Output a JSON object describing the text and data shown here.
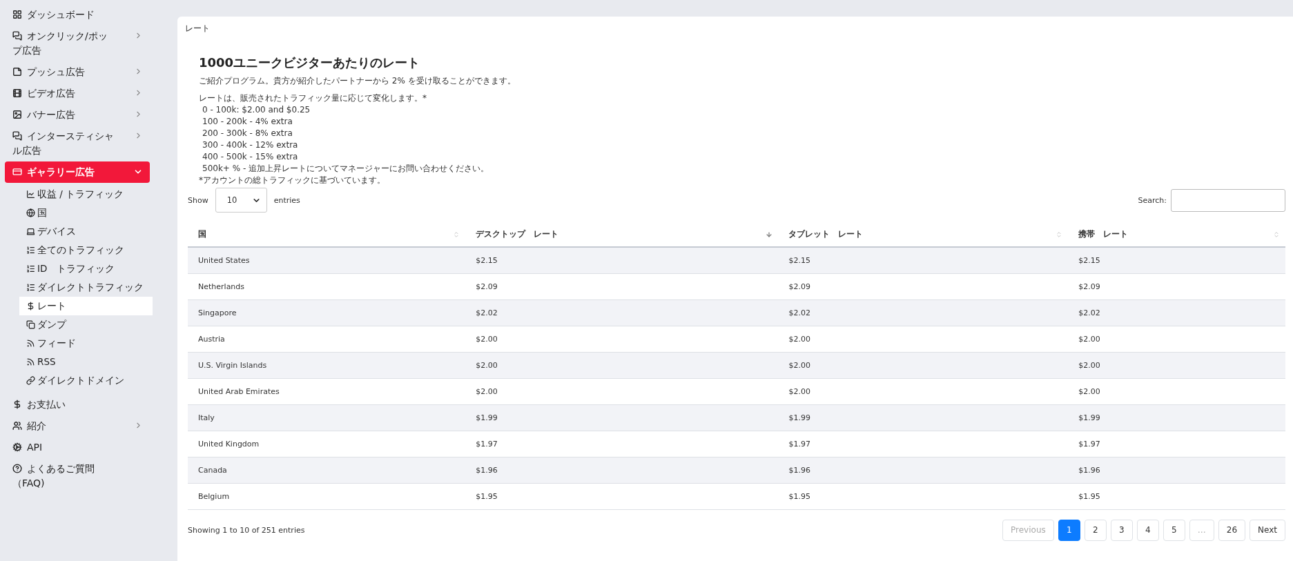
{
  "sidebar": {
    "items": [
      {
        "label": "ダッシュボード",
        "selected": false
      },
      {
        "label": "オンクリック/ポップ広告",
        "selected": false,
        "expanded": false
      },
      {
        "label": "プッシュ広告",
        "selected": false,
        "expanded": false
      },
      {
        "label": "ビデオ広告",
        "selected": false,
        "expanded": false
      },
      {
        "label": "バナー広告",
        "selected": false,
        "expanded": false
      },
      {
        "label": "インタースティシャル広告",
        "selected": false,
        "expanded": false
      },
      {
        "label": "ギャラリー広告",
        "selected": true,
        "expanded": true,
        "children": [
          {
            "label": "収益 / トラフィック",
            "selected": false
          },
          {
            "label": "国",
            "selected": false
          },
          {
            "label": "デバイス",
            "selected": false
          },
          {
            "label": "全てのトラフィック",
            "selected": false
          },
          {
            "label": "ID　トラフィック",
            "selected": false
          },
          {
            "label": "ダイレクトトラフィック",
            "selected": false
          },
          {
            "label": "レート",
            "selected": true
          },
          {
            "label": "ダンプ",
            "selected": false
          },
          {
            "label": "フィード",
            "selected": false
          },
          {
            "label": "RSS",
            "selected": false
          },
          {
            "label": "ダイレクトドメイン",
            "selected": false
          }
        ]
      },
      {
        "label": "お支払い",
        "selected": false
      },
      {
        "label": "紹介",
        "selected": false,
        "expanded": false
      },
      {
        "label": "API",
        "selected": false
      },
      {
        "label": "よくあるご質問（FAQ)",
        "selected": false
      }
    ]
  },
  "breadcrumb": "レート",
  "title": "1000ユニークビジターあたりのレート",
  "description": "ご紹介プログラム。貴方が紹介したパートナーから 2% を受け取ることができます。",
  "rates_intro": "レートは、販売されたトラフィック量に応じて変化します。*",
  "rate_tiers": [
    "0 - 100k: $2.00 and $0.25",
    "100 - 200k - 4% extra",
    "200 - 300k - 8% extra",
    "300 - 400k - 12% extra",
    "400 - 500k - 15% extra",
    "500k+ % - 追加上昇レートについてマネージャーにお問い合わせください。"
  ],
  "footnote": "*アカウントの総トラフィックに基づいています。",
  "length_control": {
    "show_label": "Show",
    "value": "10",
    "entries_label": "entries"
  },
  "search": {
    "label": "Search:"
  },
  "table": {
    "columns": [
      {
        "label": "国",
        "sorted": false
      },
      {
        "label": "デスクトップ　レート",
        "sorted": true
      },
      {
        "label": "タブレット　レート",
        "sorted": false
      },
      {
        "label": "携帯　レート",
        "sorted": false
      }
    ],
    "rows": [
      [
        "United States",
        "$2.15",
        "$2.15",
        "$2.15"
      ],
      [
        "Netherlands",
        "$2.09",
        "$2.09",
        "$2.09"
      ],
      [
        "Singapore",
        "$2.02",
        "$2.02",
        "$2.02"
      ],
      [
        "Austria",
        "$2.00",
        "$2.00",
        "$2.00"
      ],
      [
        "U.S. Virgin Islands",
        "$2.00",
        "$2.00",
        "$2.00"
      ],
      [
        "United Arab Emirates",
        "$2.00",
        "$2.00",
        "$2.00"
      ],
      [
        "Italy",
        "$1.99",
        "$1.99",
        "$1.99"
      ],
      [
        "United Kingdom",
        "$1.97",
        "$1.97",
        "$1.97"
      ],
      [
        "Canada",
        "$1.96",
        "$1.96",
        "$1.96"
      ],
      [
        "Belgium",
        "$1.95",
        "$1.95",
        "$1.95"
      ]
    ]
  },
  "info": "Showing 1 to 10 of 251 entries",
  "pagination": [
    {
      "label": "Previous",
      "selected": false,
      "disabled": true
    },
    {
      "label": "1",
      "selected": true,
      "disabled": false
    },
    {
      "label": "2",
      "selected": false,
      "disabled": false
    },
    {
      "label": "3",
      "selected": false,
      "disabled": false
    },
    {
      "label": "4",
      "selected": false,
      "disabled": false
    },
    {
      "label": "5",
      "selected": false,
      "disabled": false
    },
    {
      "label": "…",
      "selected": false,
      "disabled": true
    },
    {
      "label": "26",
      "selected": false,
      "disabled": false
    },
    {
      "label": "Next",
      "selected": false,
      "disabled": false
    }
  ]
}
